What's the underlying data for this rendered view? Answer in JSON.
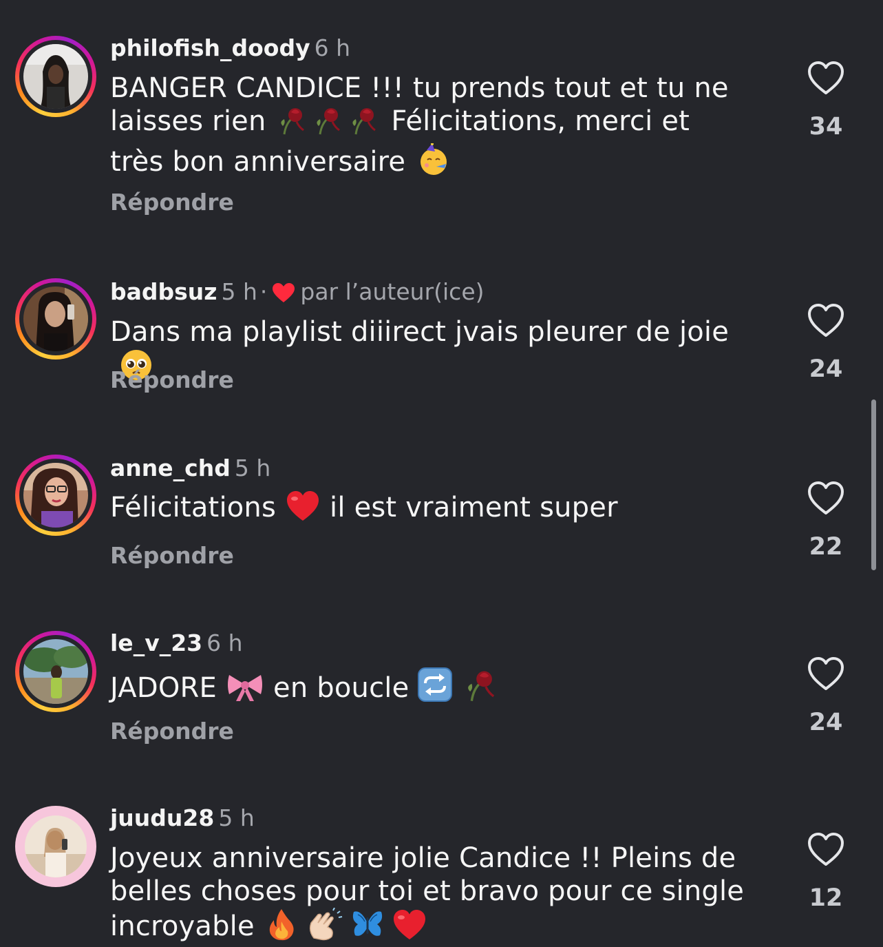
{
  "reply_label": "Répondre",
  "author_label": "par l’auteur(ice)",
  "comments": [
    {
      "username": "philofish_doody",
      "time": "6 h",
      "text_parts": [
        "BANGER CANDICE !!! tu prends tout et tu ne laisses rien ",
        " Félicitations, merci et très bon anniversaire "
      ],
      "emojis": [
        "wilted-rose",
        "wilted-rose",
        "wilted-rose",
        "partying-face"
      ],
      "likes": "34"
    },
    {
      "username": "badbsuz",
      "time": "5 h",
      "separator": "·",
      "liked_by_author": true,
      "text": "Dans ma playlist diiirect jvais pleurer de joie",
      "emojis": [
        "pleading-face"
      ],
      "likes": "24"
    },
    {
      "username": "anne_chd",
      "time": "5 h",
      "text_before": "Félicitations",
      "text_after": "il est vraiment super",
      "emojis": [
        "red-heart"
      ],
      "likes": "22"
    },
    {
      "username": "le_v_23",
      "time": "6 h",
      "text_parts": [
        "JADORE",
        "en boucle"
      ],
      "emojis": [
        "ribbon",
        "repeat-button",
        "wilted-rose"
      ],
      "likes": "24"
    },
    {
      "username": "juudu28",
      "time": "5 h",
      "text": "Joyeux anniversaire jolie Candice !! Pleins de belles choses pour toi et bravo pour ce single incroyable",
      "emojis": [
        "fire",
        "clapping-hands",
        "butterfly",
        "red-heart"
      ],
      "likes": "12"
    }
  ],
  "colors": {
    "background": "#25262b",
    "secondary_text": "#a5a7ad",
    "author_heart": "#ff2a3d"
  }
}
